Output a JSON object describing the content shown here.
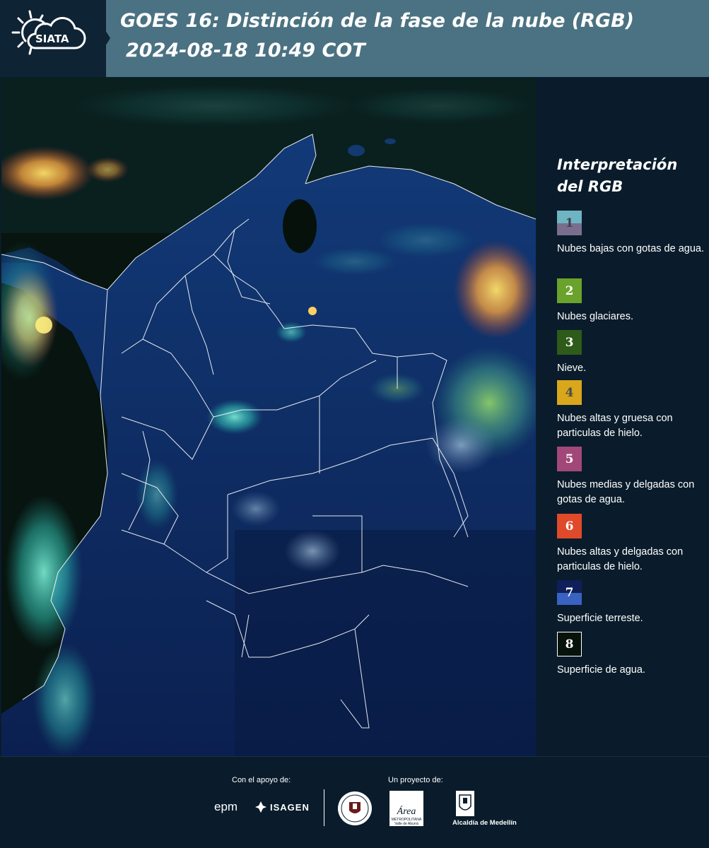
{
  "header": {
    "logo_text": "SIATA",
    "title": "GOES 16: Distinción de la fase de la nube (RGB)",
    "subtitle": "2024-08-18 10:49 COT"
  },
  "legend": {
    "title_line1": "Interpretación",
    "title_line2": "del RGB",
    "items": [
      {
        "num": "1",
        "label": "Nubes bajas con gotas de agua.",
        "color_top": "#6fb4c2",
        "color_bottom": "#7a6e8e",
        "num_color": "#3c4250"
      },
      {
        "num": "2",
        "label": "Nubes glaciares.",
        "color_top": "#6aa22c",
        "color_bottom": "#6aa22c",
        "num_color": "#ffffff"
      },
      {
        "num": "3",
        "label": "Nieve.",
        "color_top": "#2e5a1a",
        "color_bottom": "#2e5a1a",
        "num_color": "#ffffff"
      },
      {
        "num": "4",
        "label": "Nubes altas y gruesa con particulas de hielo.",
        "color_top": "#d9a61c",
        "color_bottom": "#d9a61c",
        "num_color": "#4a4a4a"
      },
      {
        "num": "5",
        "label": "Nubes medias y delgadas con gotas de agua.",
        "color_top": "#a24878",
        "color_bottom": "#a24878",
        "num_color": "#ffffff"
      },
      {
        "num": "6",
        "label": "Nubes altas y delgadas con particulas de hielo.",
        "color_top": "#e04a2a",
        "color_bottom": "#e04a2a",
        "num_color": "#ffffff"
      },
      {
        "num": "7",
        "label": "Superficie terreste.",
        "color_top": "#0e1f5a",
        "color_bottom": "#3a62c0",
        "num_color": "#ffffff"
      },
      {
        "num": "8",
        "label": "Superficie de agua.",
        "color_top": "#07120b",
        "color_bottom": "#07120b",
        "num_color": "#ffffff"
      }
    ]
  },
  "footer": {
    "support_label": "Con el apoyo de:",
    "project_label": "Un proyecto de:",
    "sponsor_epm": "epm",
    "sponsor_isagen": "ISAGEN",
    "area_logo_text": "Área",
    "area_logo_small": "METROPOLITANA Valle de Aburrá",
    "alcaldia": "Alcaldía de Medellín"
  },
  "colors": {
    "header_bg": "#4b7282",
    "page_bg": "#0a1c2b",
    "land": "#0f2a6a",
    "water": "#07120e",
    "cloud_cyan": "#4ee0d0",
    "cloud_orange": "#f0a040"
  }
}
